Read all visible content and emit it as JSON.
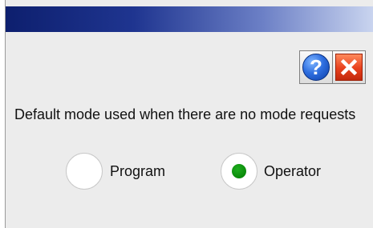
{
  "window": {
    "title": ""
  },
  "toolbar": {
    "help_glyph": "?",
    "help_icon": "help-icon",
    "close_icon": "close-icon"
  },
  "main": {
    "description": "Default mode used when there are no mode requests",
    "options": [
      {
        "label": "Program",
        "selected": false
      },
      {
        "label": "Operator",
        "selected": true
      }
    ]
  },
  "colors": {
    "title_bar_dark": "#0d1f6e",
    "title_bar_light": "#c9d4ef",
    "selected_dot": "#008000",
    "close_red": "#e8401c",
    "help_blue": "#2f6fe0"
  }
}
